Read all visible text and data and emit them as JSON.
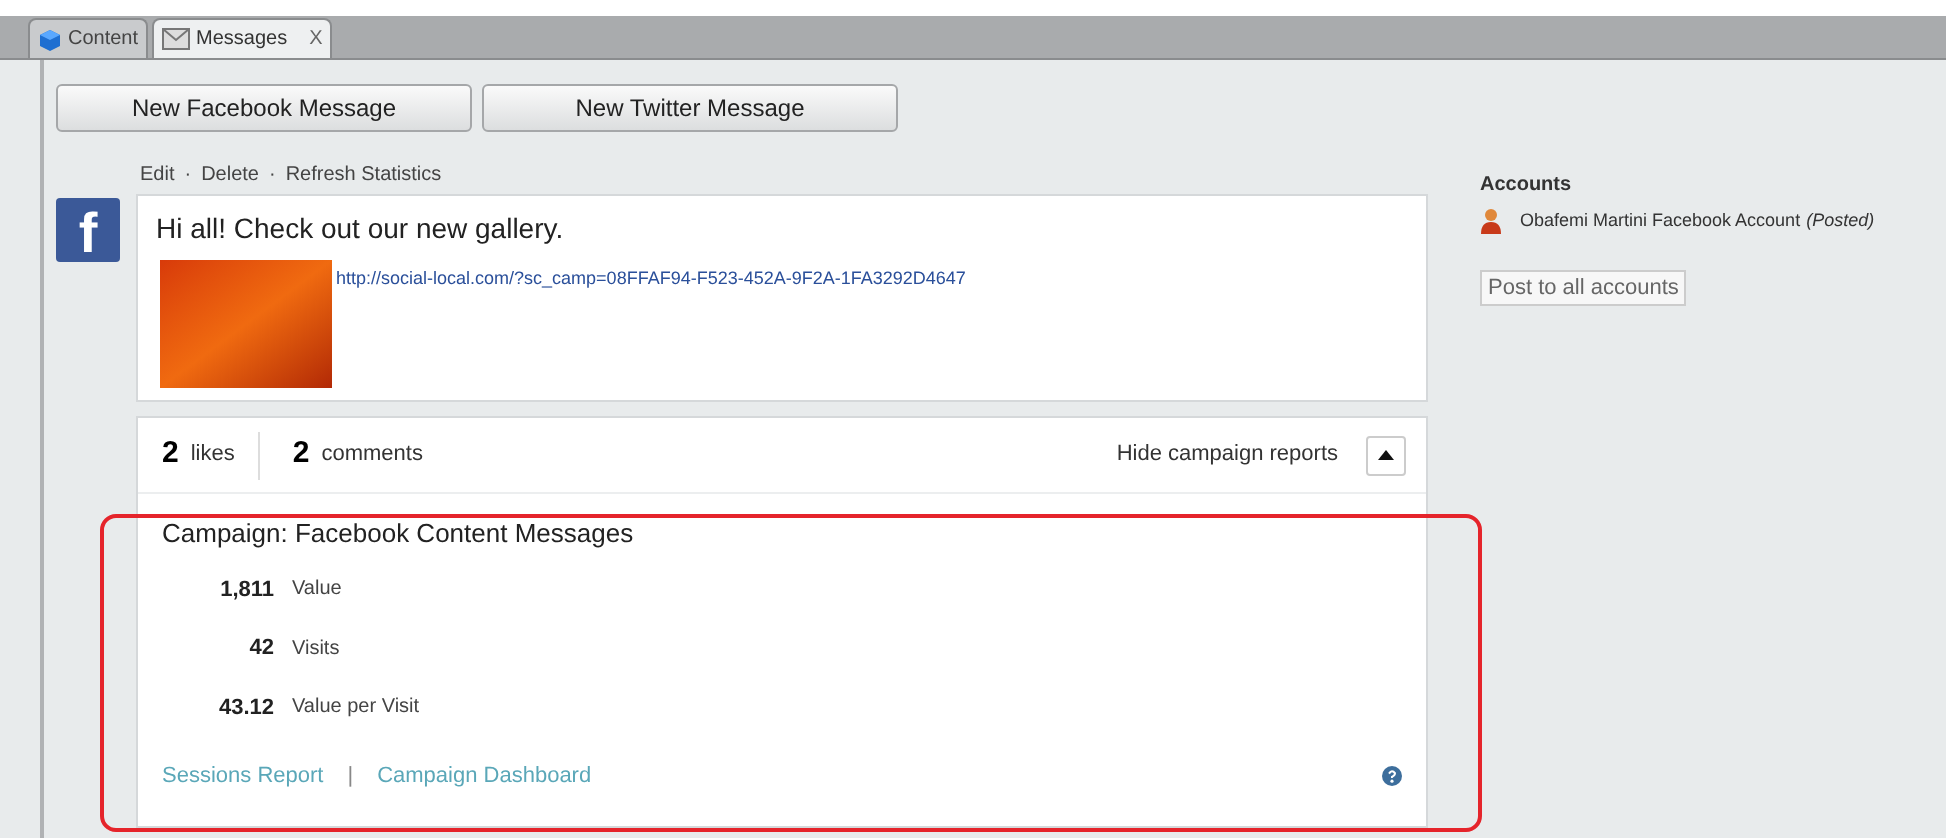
{
  "tabs": [
    {
      "label": "Content",
      "selected": false
    },
    {
      "label": "Messages",
      "selected": true,
      "close": "X"
    }
  ],
  "toolbar": {
    "buttons": [
      "New Facebook Message",
      "New Twitter Message"
    ]
  },
  "post": {
    "actions": [
      {
        "label": "Edit"
      },
      {
        "label": "Delete",
        "separator": "·"
      },
      {
        "label": "Refresh Statistics",
        "separator": "·"
      }
    ],
    "network": "f",
    "message": "Hi all! Check out our new gallery.",
    "link": "http://social-local.com/?sc_camp=08FFAF94-F523-452A-9F2A-1FA3292D4647",
    "likes": {
      "count": "2",
      "label": "likes"
    },
    "comments": {
      "count": "2",
      "label": "comments"
    },
    "toggle_label": "Hide campaign reports",
    "expanded": true
  },
  "campaign": {
    "title": "Campaign: Facebook Content Messages",
    "metrics": [
      {
        "value": "1,811",
        "label": "Value"
      },
      {
        "value": "42",
        "label": "Visits"
      },
      {
        "value": "43.12",
        "label": "Value per Visit"
      }
    ],
    "links": [
      "Sessions Report",
      "Campaign Dashboard"
    ],
    "link_separator": "|",
    "highlighted": true
  },
  "accounts": {
    "title": "Accounts",
    "items": [
      {
        "name": "Obafemi Martini Facebook Account",
        "status": "(Posted)"
      }
    ],
    "button": "Post to all accounts"
  }
}
